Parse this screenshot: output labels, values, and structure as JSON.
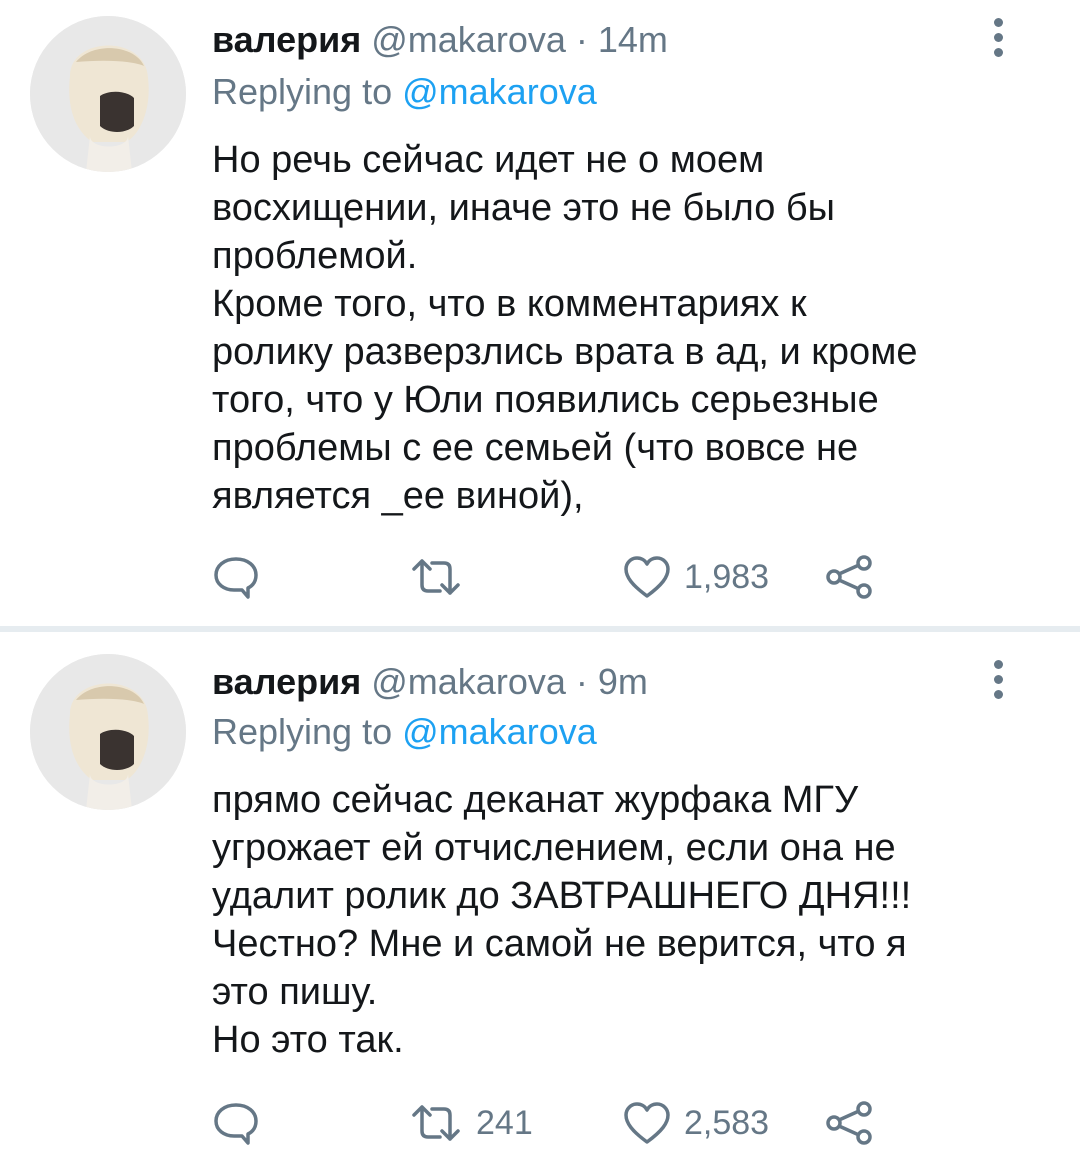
{
  "tweets": [
    {
      "display_name": "валерия",
      "handle": "@makarova",
      "separator": "·",
      "time": "14m",
      "replying_prefix": "Replying to",
      "replying_to": "@makarova",
      "text": "Но речь сейчас идет не о моем\nвосхищении, иначе это не было бы\nпроблемой.\nКроме того, что в комментариях к\nролику разверзлись врата в ад, и кроме\nтого, что у Юли появились серьезные\nпроблемы с ее семьей (что вовсе не\nявляется _ее виной),",
      "retweet_count": "",
      "like_count": "1,983",
      "icons": {
        "more": "more-vertical-icon",
        "reply": "reply-icon",
        "retweet": "retweet-icon",
        "like": "heart-icon",
        "share": "share-icon"
      }
    },
    {
      "display_name": "валерия",
      "handle": "@makarova",
      "separator": "·",
      "time": "9m",
      "replying_prefix": "Replying to",
      "replying_to": "@makarova",
      "text": "прямо сейчас деканат журфака МГУ\nугрожает ей отчислением, если она не\nудалит ролик до ЗАВТРАШНЕГО ДНЯ!!!\nЧестно? Мне и самой не верится, что я\nэто пишу.\nНо это так.",
      "retweet_count": "241",
      "like_count": "2,583",
      "icons": {
        "more": "more-vertical-icon",
        "reply": "reply-icon",
        "retweet": "retweet-icon",
        "like": "heart-icon",
        "share": "share-icon"
      }
    }
  ],
  "colors": {
    "text": "#14171a",
    "muted": "#657786",
    "link": "#1da1f2",
    "divider": "#e6ecf0"
  }
}
